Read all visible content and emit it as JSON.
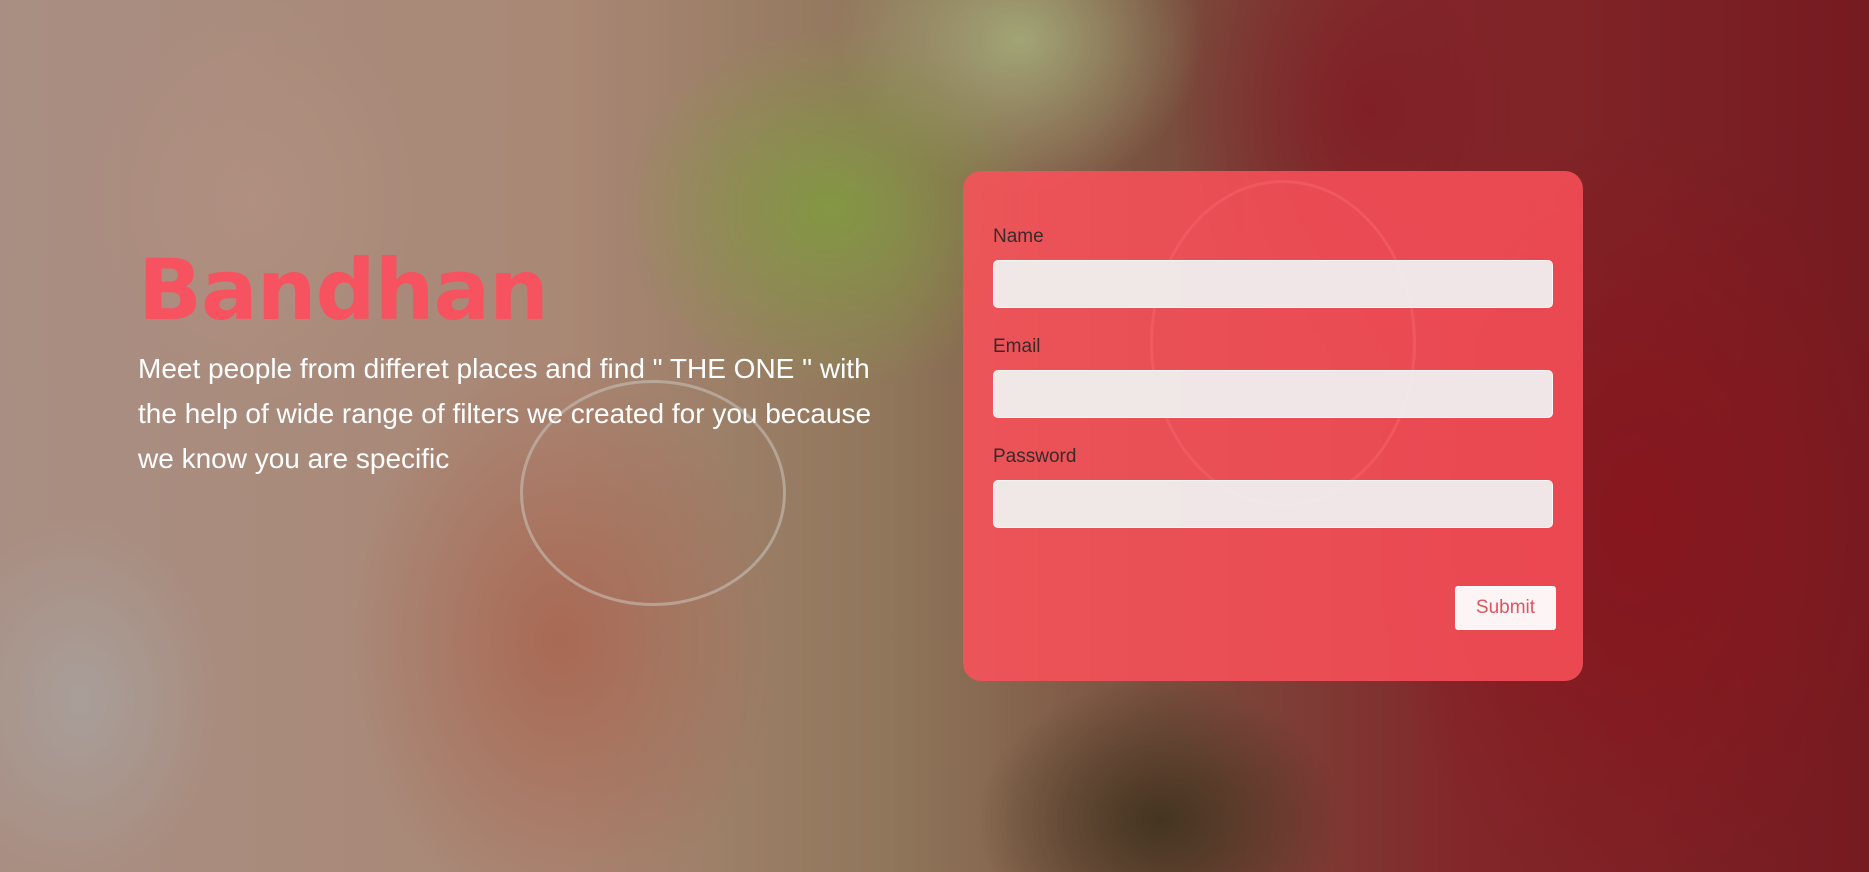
{
  "hero": {
    "title": "Bandhan",
    "tagline": "Meet people from differet places and find \" THE ONE \" with the help of wide range of filters we created for you because we know you are specific"
  },
  "form": {
    "name_label": "Name",
    "name_value": "",
    "email_label": "Email",
    "email_value": "",
    "password_label": "Password",
    "password_value": "",
    "submit_label": "Submit"
  },
  "colors": {
    "brand": "#f7525f",
    "card": "#fc505a",
    "text_light": "#ffffff"
  }
}
